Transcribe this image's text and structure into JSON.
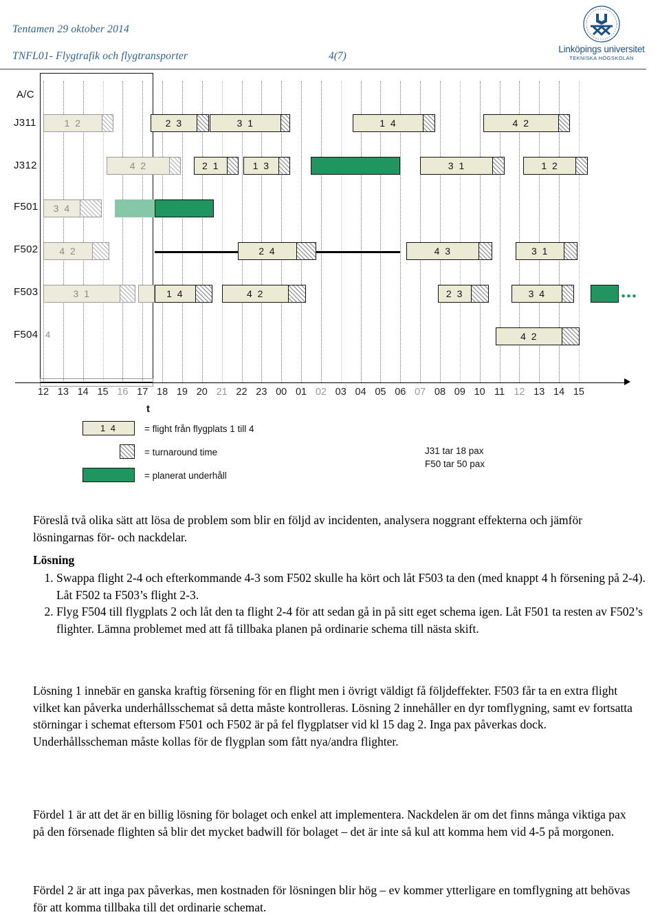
{
  "header": {
    "line1": "Tentamen 29 oktober 2014",
    "line2": "TNFL01- Flygtrafik och flygtransporter",
    "page": "4(7)",
    "logo_name": "Linköpings universitet",
    "logo_sub": "TEKNISKA HÖGSKOLAN",
    "accent_color": "#2e5f8a"
  },
  "chart_data": {
    "type": "gantt",
    "title": "",
    "ylabel": "A/C",
    "xlabel": "t",
    "rows": [
      "J311",
      "J312",
      "F501",
      "F502",
      "F503",
      "F504"
    ],
    "tick_labels": [
      "12",
      "13",
      "14",
      "15",
      "16",
      "17",
      "18",
      "19",
      "20",
      "21",
      "22",
      "23",
      "00",
      "01",
      "02",
      "03",
      "04",
      "05",
      "06",
      "07",
      "08",
      "09",
      "10",
      "11",
      "12",
      "13",
      "14",
      "15"
    ],
    "xlim": [
      12,
      39
    ],
    "f504_marker": "4",
    "series": [
      {
        "row": "J311",
        "bars": [
          {
            "label": "1 2",
            "start": 12.0,
            "end": 15.0,
            "turn_end": 15.6,
            "style": "pale"
          },
          {
            "label": "2 3",
            "start": 17.4,
            "end": 19.8,
            "turn_end": 20.4,
            "style": "normal"
          },
          {
            "label": "3 1",
            "start": 20.4,
            "end": 24.0,
            "turn_end": 24.5,
            "style": "normal"
          },
          {
            "label": "1 4",
            "start": 27.6,
            "end": 31.2,
            "turn_end": 31.8,
            "style": "normal"
          },
          {
            "label": "4 2",
            "start": 34.2,
            "end": 38.0,
            "turn_end": 38.6,
            "style": "normal"
          }
        ]
      },
      {
        "row": "J312",
        "bars": [
          {
            "label": "4 2",
            "start": 15.2,
            "end": 18.4,
            "turn_end": 19.0,
            "style": "pale"
          },
          {
            "label": "2 1",
            "start": 19.6,
            "end": 21.3,
            "turn_end": 21.9,
            "style": "normal"
          },
          {
            "label": "1 3",
            "start": 22.1,
            "end": 23.9,
            "turn_end": 24.5,
            "style": "normal"
          },
          {
            "label": "",
            "start": 25.5,
            "end": 30.0,
            "turn_end": 30.0,
            "style": "maint"
          },
          {
            "label": "3 1",
            "start": 31.0,
            "end": 34.7,
            "turn_end": 35.3,
            "style": "normal"
          },
          {
            "label": "1 2",
            "start": 36.2,
            "end": 38.9,
            "turn_end": 39.5,
            "style": "normal"
          }
        ]
      },
      {
        "row": "F501",
        "bars": [
          {
            "label": "3 4",
            "start": 12.0,
            "end": 13.9,
            "turn_end": 15.0,
            "style": "pale"
          },
          {
            "label": "",
            "start": 15.6,
            "end": 17.6,
            "turn_end": 17.6,
            "style": "maint-pale"
          },
          {
            "label": "",
            "start": 17.6,
            "end": 20.6,
            "turn_end": 20.6,
            "style": "maint"
          }
        ]
      },
      {
        "row": "F502",
        "bars": [
          {
            "label": "4 2",
            "start": 12.0,
            "end": 14.5,
            "turn_end": 15.4,
            "style": "pale"
          },
          {
            "label": "2 4",
            "start": 21.8,
            "end": 24.8,
            "turn_end": 25.8,
            "style": "normal"
          },
          {
            "label": "4 3",
            "start": 30.3,
            "end": 34.0,
            "turn_end": 34.7,
            "style": "normal"
          },
          {
            "label": "3 1",
            "start": 35.8,
            "end": 38.3,
            "turn_end": 39.0,
            "style": "normal"
          }
        ]
      },
      {
        "row": "F503",
        "bars": [
          {
            "label": "3 1",
            "start": 12.0,
            "end": 15.9,
            "turn_end": 16.7,
            "style": "pale"
          },
          {
            "label": "",
            "start": 16.8,
            "end": 17.6,
            "turn_end": 17.6,
            "style": "stub"
          },
          {
            "label": "1 4",
            "start": 17.6,
            "end": 19.7,
            "turn_end": 20.6,
            "style": "normal"
          },
          {
            "label": "4 2",
            "start": 21.0,
            "end": 24.4,
            "turn_end": 25.3,
            "style": "normal"
          },
          {
            "label": "2 3",
            "start": 31.9,
            "end": 33.6,
            "turn_end": 34.5,
            "style": "normal"
          },
          {
            "label": "3 4",
            "start": 35.6,
            "end": 38.2,
            "turn_end": 38.8,
            "style": "normal"
          },
          {
            "label": "",
            "start": 39.6,
            "end": 41.0,
            "turn_end": 41.0,
            "style": "maint"
          }
        ]
      },
      {
        "row": "F504",
        "bars": [
          {
            "label": "4 2",
            "start": 34.8,
            "end": 38.2,
            "turn_end": 39.1,
            "style": "normal"
          }
        ]
      }
    ],
    "incident_line": {
      "row": "F502",
      "start": 17.6,
      "end": 30.0
    },
    "selection_box": {
      "start": 12.0,
      "end": 17.6
    },
    "legend": [
      {
        "swatch": "flight-box",
        "label_inside": "1 4",
        "text": "= flight från flygplats 1 till 4"
      },
      {
        "swatch": "turnaround-hatch",
        "label_inside": "",
        "text": "= turnaround time"
      },
      {
        "swatch": "maintenance-green",
        "label_inside": "",
        "text": "= planerat underhåll"
      }
    ],
    "notes": [
      "J31 tar 18 pax",
      "F50 tar 50 pax"
    ],
    "colors": {
      "flight": "#ebead4",
      "maintenance": "#21955f",
      "maintenance_pale": "#85c7a8"
    }
  },
  "body": {
    "intro": "Föreslå två olika sätt att lösa de problem som blir en följd av incidenten, analysera noggrant effekterna och jämför lösningarnas för- och nackdelar.",
    "solution_heading": "Lösning",
    "solution_items": [
      "Swappa flight 2-4 och efterkommande 4-3 som F502 skulle ha kört och låt F503 ta den (med knappt 4 h försening på 2-4). Låt F502 ta F503’s flight 2-3.",
      "Flyg F504 till flygplats 2 och låt den ta flight 2-4 för att sedan gå in på sitt eget schema igen. Låt F501 ta resten av F502’s flighter. Lämna problemet med att få tillbaka planen på ordinarie schema till nästa skift."
    ],
    "para2": "Lösning 1 innebär en ganska kraftig försening för en flight men i övrigt väldigt få följdeffekter. F503 får ta en extra flight vilket kan påverka underhållsschemat så detta måste kontrolleras. Lösning 2 innehåller en dyr tomflygning, samt ev fortsatta störningar i schemat eftersom F501 och F502 är på fel flygplatser vid kl 15 dag 2. Inga pax påverkas dock. Underhållsscheman måste kollas för de flygplan som fått nya/andra flighter.",
    "para3": "Fördel 1 är att det är en billig lösning för bolaget och enkel att implementera. Nackdelen är om det finns många viktiga pax på den försenade flighten så blir det mycket badwill för bolaget – det är inte så kul att komma hem vid 4-5 på morgonen.",
    "para4": "Fördel 2 är att inga pax påverkas, men kostnaden för lösningen blir hög – ev kommer ytterligare en tomflygning att behövas för att komma tillbaka till det ordinarie schemat."
  }
}
